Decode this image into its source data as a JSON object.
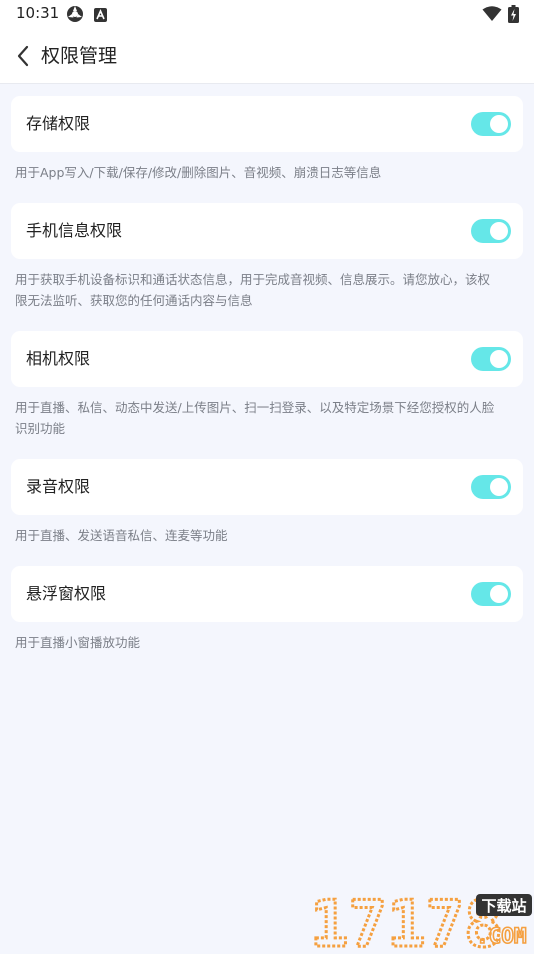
{
  "status_bar": {
    "time": "10:31"
  },
  "header": {
    "title": "权限管理"
  },
  "permissions": [
    {
      "label": "存储权限",
      "enabled": true,
      "description": "用于App写入/下载/保存/修改/删除图片、音视频、崩溃日志等信息"
    },
    {
      "label": "手机信息权限",
      "enabled": true,
      "description_lines": [
        "用于获取手机设备标识和通话状态信息，用于完成音视频、信息展示。请您放心，该权",
        "限无法监听、获取您的任何通话内容与信息"
      ]
    },
    {
      "label": "相机权限",
      "enabled": true,
      "description_lines": [
        "用于直播、私信、动态中发送/上传图片、扫一扫登录、以及特定场景下经您授权的人脸",
        "识别功能"
      ]
    },
    {
      "label": "录音权限",
      "enabled": true,
      "description": "用于直播、发送语音私信、连麦等功能"
    },
    {
      "label": "悬浮窗权限",
      "enabled": true,
      "description": "用于直播小窗播放功能"
    }
  ],
  "watermark": {
    "digits": "17178",
    "tag": "下载站",
    "domain": ".COM"
  },
  "colors": {
    "toggle_on": "#65e7e8",
    "background": "#f4f6fd",
    "card": "#ffffff",
    "description_text": "#7b7f88",
    "watermark_orange": "#f5a040"
  }
}
